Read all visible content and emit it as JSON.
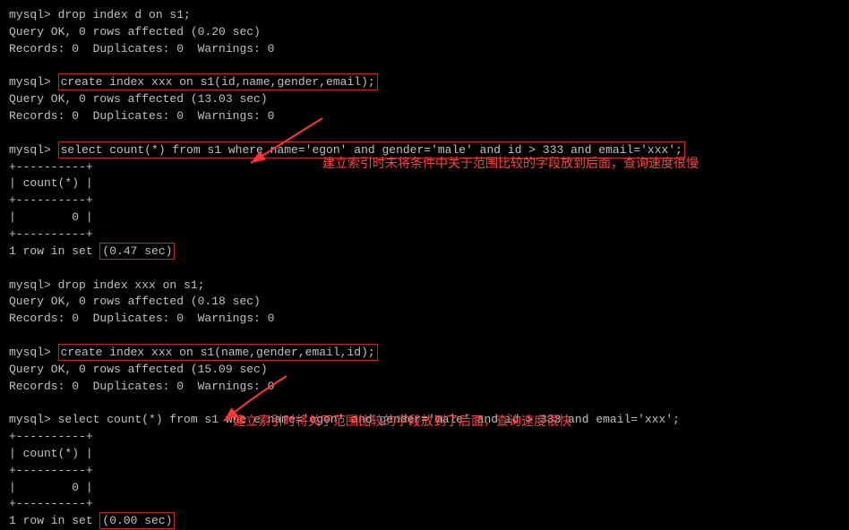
{
  "terminal": {
    "lines": [
      {
        "type": "cmd",
        "text": "mysql> drop index d on s1;"
      },
      {
        "type": "out",
        "text": "Query OK, 0 rows affected (0.20 sec)"
      },
      {
        "type": "out",
        "text": "Records: 0  Duplicates: 0  Warnings: 0"
      },
      {
        "type": "blank",
        "text": ""
      },
      {
        "type": "cmd_highlight",
        "text": "mysql> create index xxx on s1(id,name,gender,email);"
      },
      {
        "type": "out",
        "text": "Query OK, 0 rows affected (13.03 sec)"
      },
      {
        "type": "out",
        "text": "Records: 0  Duplicates: 0  Warnings: 0"
      },
      {
        "type": "blank",
        "text": ""
      },
      {
        "type": "cmd_highlight2",
        "text": "mysql> select count(*) from s1 where name='egon' and gender='male' and id > 333 and email='xxx';"
      },
      {
        "type": "table_border",
        "text": "+----------+"
      },
      {
        "type": "table_header",
        "text": "| count(*) |"
      },
      {
        "type": "table_border",
        "text": "+----------+"
      },
      {
        "type": "table_data",
        "text": "|        0 |"
      },
      {
        "type": "table_border",
        "text": "+----------+"
      },
      {
        "type": "result_highlight",
        "text": "1 row in set (0.47 sec)"
      },
      {
        "type": "blank",
        "text": ""
      },
      {
        "type": "cmd",
        "text": "mysql> drop index xxx on s1;"
      },
      {
        "type": "out",
        "text": "Query OK, 0 rows affected (0.18 sec)"
      },
      {
        "type": "out",
        "text": "Records: 0  Duplicates: 0  Warnings: 0"
      },
      {
        "type": "blank",
        "text": ""
      },
      {
        "type": "cmd_highlight3",
        "text": "mysql> create index xxx on s1(name,gender,email,id);"
      },
      {
        "type": "out",
        "text": "Query OK, 0 rows affected (15.09 sec)"
      },
      {
        "type": "out",
        "text": "Records: 0  Duplicates: 0  Warnings: 0"
      },
      {
        "type": "blank",
        "text": ""
      },
      {
        "type": "cmd",
        "text": "mysql> select count(*) from s1 whe re name='egon' and gender='male' and id > 333 and email='xxx';"
      },
      {
        "type": "table_border",
        "text": "+----------+"
      },
      {
        "type": "table_header",
        "text": "| count(*) |"
      },
      {
        "type": "table_border",
        "text": "+----------+"
      },
      {
        "type": "table_data",
        "text": "|        0 |"
      },
      {
        "type": "table_border",
        "text": "+----------+"
      },
      {
        "type": "result_highlight2",
        "text": "1 row in set (0.00 sec)"
      }
    ],
    "annotation1": "建立索引时未将条件中关于范围比较的字段放到后面，查询速度很慢",
    "annotation2": "建立索引时将关于范围比较的字段放到了后面，查询速度很快"
  }
}
